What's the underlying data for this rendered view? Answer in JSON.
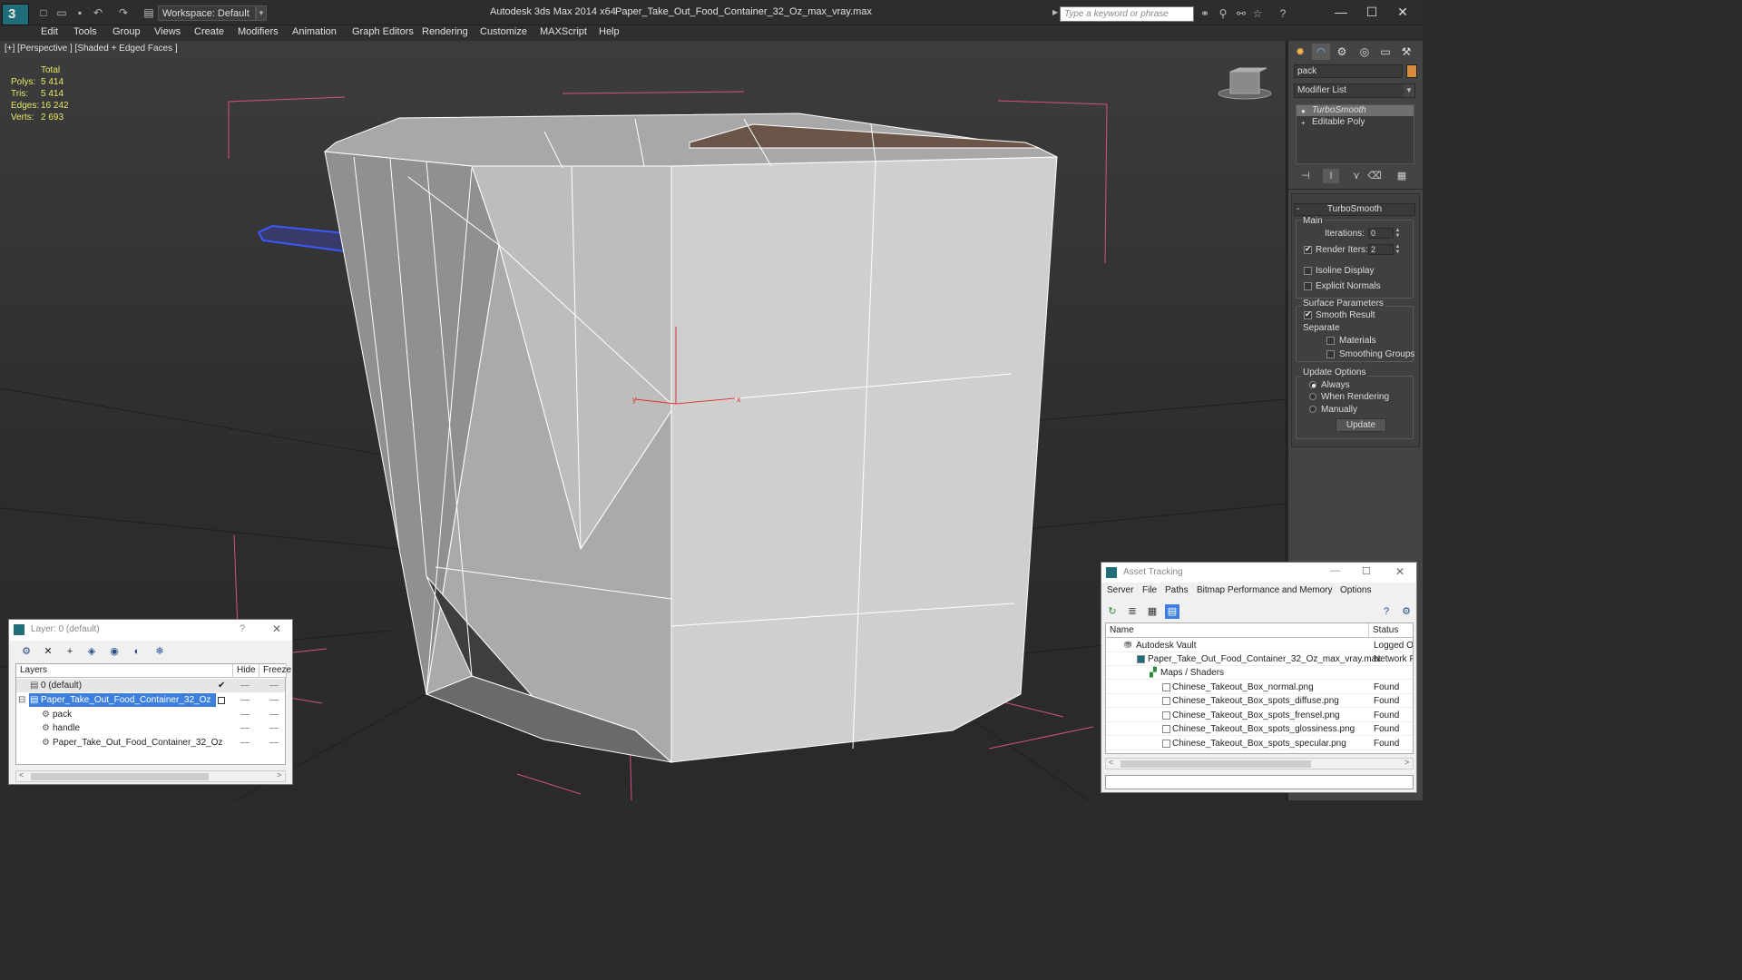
{
  "titlebar": {
    "app": "Autodesk 3ds Max  2014 x64",
    "file": "Paper_Take_Out_Food_Container_32_Oz_max_vray.max",
    "workspace": "Workspace: Default",
    "search_placeholder": "Type a keyword or phrase",
    "minimize": "—",
    "maximize": "☐",
    "close": "✕"
  },
  "menu": [
    "Edit",
    "Tools",
    "Group",
    "Views",
    "Create",
    "Modifiers",
    "Animation",
    "Graph Editors",
    "Rendering",
    "Customize",
    "MAXScript",
    "Help"
  ],
  "viewport": {
    "label": "[+] [Perspective ] [Shaded + Edged Faces ]",
    "stats": {
      "header": "Total",
      "rows": [
        {
          "k": "Polys:",
          "v": "5 414"
        },
        {
          "k": "Tris:",
          "v": "5 414"
        },
        {
          "k": "Edges:",
          "v": "16 242"
        },
        {
          "k": "Verts:",
          "v": "2 693"
        }
      ]
    },
    "gizmo_x": "x",
    "gizmo_y": "y"
  },
  "command_panel": {
    "object_name": "pack",
    "object_color": "#d88a3c",
    "modifier_list": "Modifier List",
    "stack": [
      "TurboSmooth",
      "Editable Poly"
    ],
    "rollout": "TurboSmooth",
    "main_label": "Main",
    "iterations_label": "Iterations:",
    "iterations_value": "0",
    "render_iters_label": "Render Iters:",
    "render_iters_value": "2",
    "isoline": "Isoline Display",
    "explicit": "Explicit Normals",
    "surface_label": "Surface Parameters",
    "smooth_result": "Smooth Result",
    "separate": "Separate",
    "materials": "Materials",
    "smoothing_groups": "Smoothing Groups",
    "update_options": "Update Options",
    "always": "Always",
    "when_rendering": "When Rendering",
    "manually": "Manually",
    "update": "Update"
  },
  "layer_window": {
    "title": "Layer: 0 (default)",
    "help": "?",
    "close": "✕",
    "col_layers": "Layers",
    "col_hide": "Hide",
    "col_freeze": "Freeze",
    "rows": [
      {
        "name": "0 (default)"
      },
      {
        "name": "Paper_Take_Out_Food_Container_32_Oz"
      },
      {
        "name": "pack"
      },
      {
        "name": "handle"
      },
      {
        "name": "Paper_Take_Out_Food_Container_32_Oz"
      }
    ]
  },
  "asset_window": {
    "title": "Asset Tracking",
    "menu": [
      "Server",
      "File",
      "Paths",
      "Bitmap Performance and Memory",
      "Options"
    ],
    "col_name": "Name",
    "col_status": "Status",
    "rows": [
      {
        "name": "Autodesk Vault",
        "status": "Logged Out"
      },
      {
        "name": "Paper_Take_Out_Food_Container_32_Oz_max_vray.max",
        "status": "Network Path"
      },
      {
        "name": "Maps / Shaders",
        "status": ""
      },
      {
        "name": "Chinese_Takeout_Box_normal.png",
        "status": "Found"
      },
      {
        "name": "Chinese_Takeout_Box_spots_diffuse.png",
        "status": "Found"
      },
      {
        "name": "Chinese_Takeout_Box_spots_frensel.png",
        "status": "Found"
      },
      {
        "name": "Chinese_Takeout_Box_spots_glossiness.png",
        "status": "Found"
      },
      {
        "name": "Chinese_Takeout_Box_spots_specular.png",
        "status": "Found"
      }
    ]
  }
}
